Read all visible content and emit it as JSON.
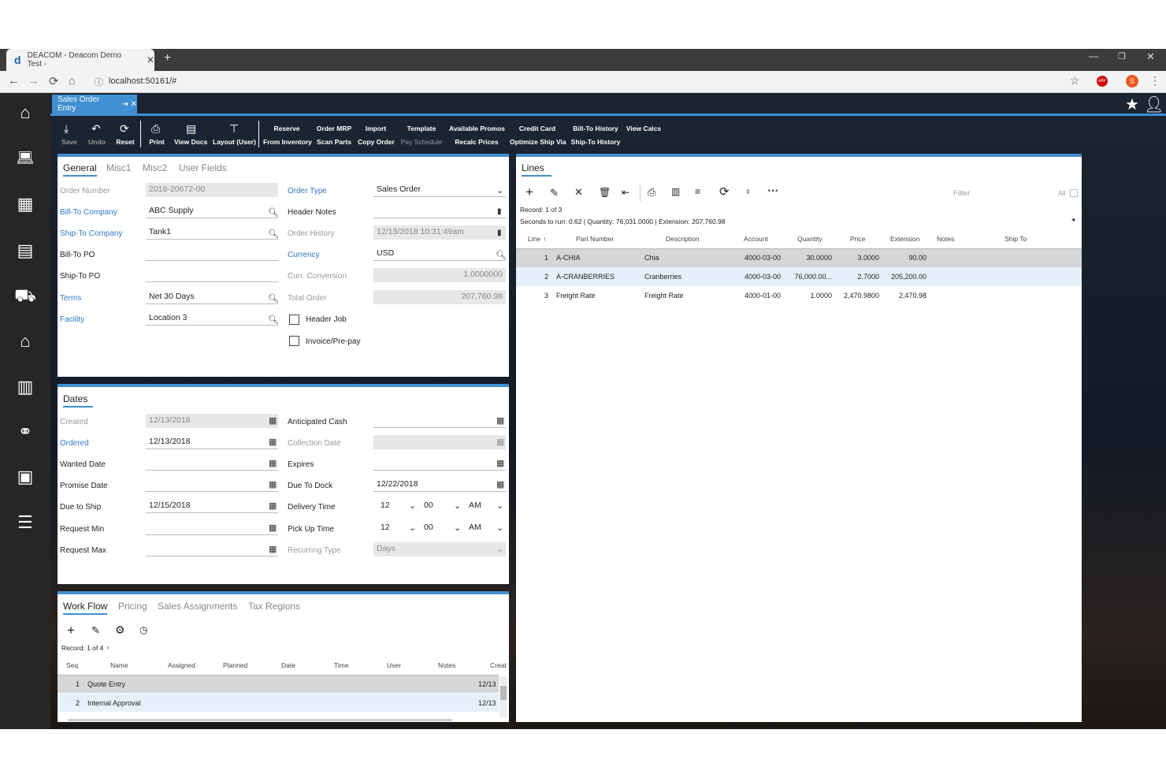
{
  "browser": {
    "tab_title": "DEACOM - Deacom Demo Test -",
    "url": "localhost:50161/#",
    "profile_initial": "S",
    "abp": "ABP"
  },
  "app": {
    "form_tab": "Sales Order Entry"
  },
  "toolbar": {
    "save": "Save",
    "undo": "Undo",
    "reset": "Reset",
    "print": "Print",
    "view_docs": "View Docs",
    "layout": "Layout (User)",
    "reserve": "Reserve",
    "from_inventory": "From Inventory",
    "order_mrp": "Order MRP",
    "scan_parts": "Scan Parts",
    "import": "Import",
    "copy_order": "Copy Order",
    "template": "Template",
    "pay_schedule": "Pay Schedule",
    "available_promos": "Available Promos",
    "recalc_prices": "Recalc Prices",
    "credit_card": "Credit Card",
    "optimize_ship_via": "Optimize Ship Via",
    "bill_to_history": "Bill-To History",
    "ship_to_history": "Ship-To History",
    "view_calcs": "View Calcs"
  },
  "general": {
    "tabs": [
      "General",
      "Misc1",
      "Misc2",
      "User Fields"
    ],
    "order_number_label": "Order Number",
    "order_number": "2018-20672-00",
    "bill_to_label": "Bill-To Company",
    "bill_to": "ABC Supply",
    "ship_to_label": "Ship-To Company",
    "ship_to": "Tank1",
    "bill_po_label": "Bill-To PO",
    "bill_po": "",
    "ship_po_label": "Ship-To PO",
    "ship_po": "",
    "terms_label": "Terms",
    "terms": "Net 30 Days",
    "facility_label": "Facility",
    "facility": "Location 3",
    "order_type_label": "Order Type",
    "order_type": "Sales Order",
    "header_notes_label": "Header Notes",
    "header_notes": "",
    "order_history_label": "Order History",
    "order_history": "12/13/2018  10:31:49am",
    "currency_label": "Currency",
    "currency": "USD",
    "conversion_label": "Curr. Conversion",
    "conversion": "1.0000000",
    "total_label": "Total Order",
    "total": "207,760.98",
    "header_job_label": "Header Job",
    "invoice_label": "Invoice/Pre-pay"
  },
  "dates": {
    "title": "Dates",
    "created_label": "Created",
    "created": "12/13/2018",
    "ordered_label": "Ordered",
    "ordered": "12/13/2018",
    "wanted_label": "Wanted Date",
    "wanted": "",
    "promise_label": "Promise Date",
    "promise": "",
    "due_ship_label": "Due to Ship",
    "due_ship": "12/15/2018",
    "req_min_label": "Request Min",
    "req_min": "",
    "req_max_label": "Request Max",
    "req_max": "",
    "anticipated_label": "Anticipated Cash",
    "collection_label": "Collection Date",
    "expires_label": "Expires",
    "due_dock_label": "Due To Dock",
    "due_dock": "12/22/2018",
    "delivery_label": "Delivery Time",
    "pickup_label": "Pick Up Time",
    "hour": "12",
    "minute": "00",
    "ampm": "AM",
    "recurring_label": "Recurring Type",
    "recurring": "Days"
  },
  "workflow": {
    "tabs": [
      "Work Flow",
      "Pricing",
      "Sales Assignments",
      "Tax Regions"
    ],
    "record": "Record: 1 of 4",
    "columns": [
      "Seq",
      "Name",
      "Assigned",
      "Planned",
      "Date",
      "Time",
      "User",
      "Notes",
      "Creat"
    ],
    "rows": [
      {
        "seq": "1",
        "name": "Quote Entry",
        "creat": "12/13"
      },
      {
        "seq": "2",
        "name": "Internal Approval",
        "creat": "12/13"
      }
    ]
  },
  "lines": {
    "title": "Lines",
    "filter": "Filter",
    "all": "All",
    "record": "Record: 1 of 3",
    "summary": "Seconds to run: 0.62  |  Quantity: 76,031.0000  |  Extension: 207,760.98",
    "columns": [
      "Line",
      "Part Number",
      "Description",
      "Account",
      "Quantity",
      "Price",
      "Extension",
      "Notes",
      "Ship To"
    ],
    "rows": [
      {
        "line": "1",
        "part": "A-CHIA",
        "desc": "Chia",
        "account": "4000-03-00",
        "qty": "30.0000",
        "price": "3.0000",
        "ext": "90.00"
      },
      {
        "line": "2",
        "part": "A-CRANBERRIES",
        "desc": "Cranberries",
        "account": "4000-03-00",
        "qty": "76,000.00...",
        "price": "2.7000",
        "ext": "205,200.00"
      },
      {
        "line": "3",
        "part": "Freight Rate",
        "desc": "Freight Rate",
        "account": "4000-01-00",
        "qty": "1.0000",
        "price": "2,470.9800",
        "ext": "2,470.98"
      }
    ]
  }
}
